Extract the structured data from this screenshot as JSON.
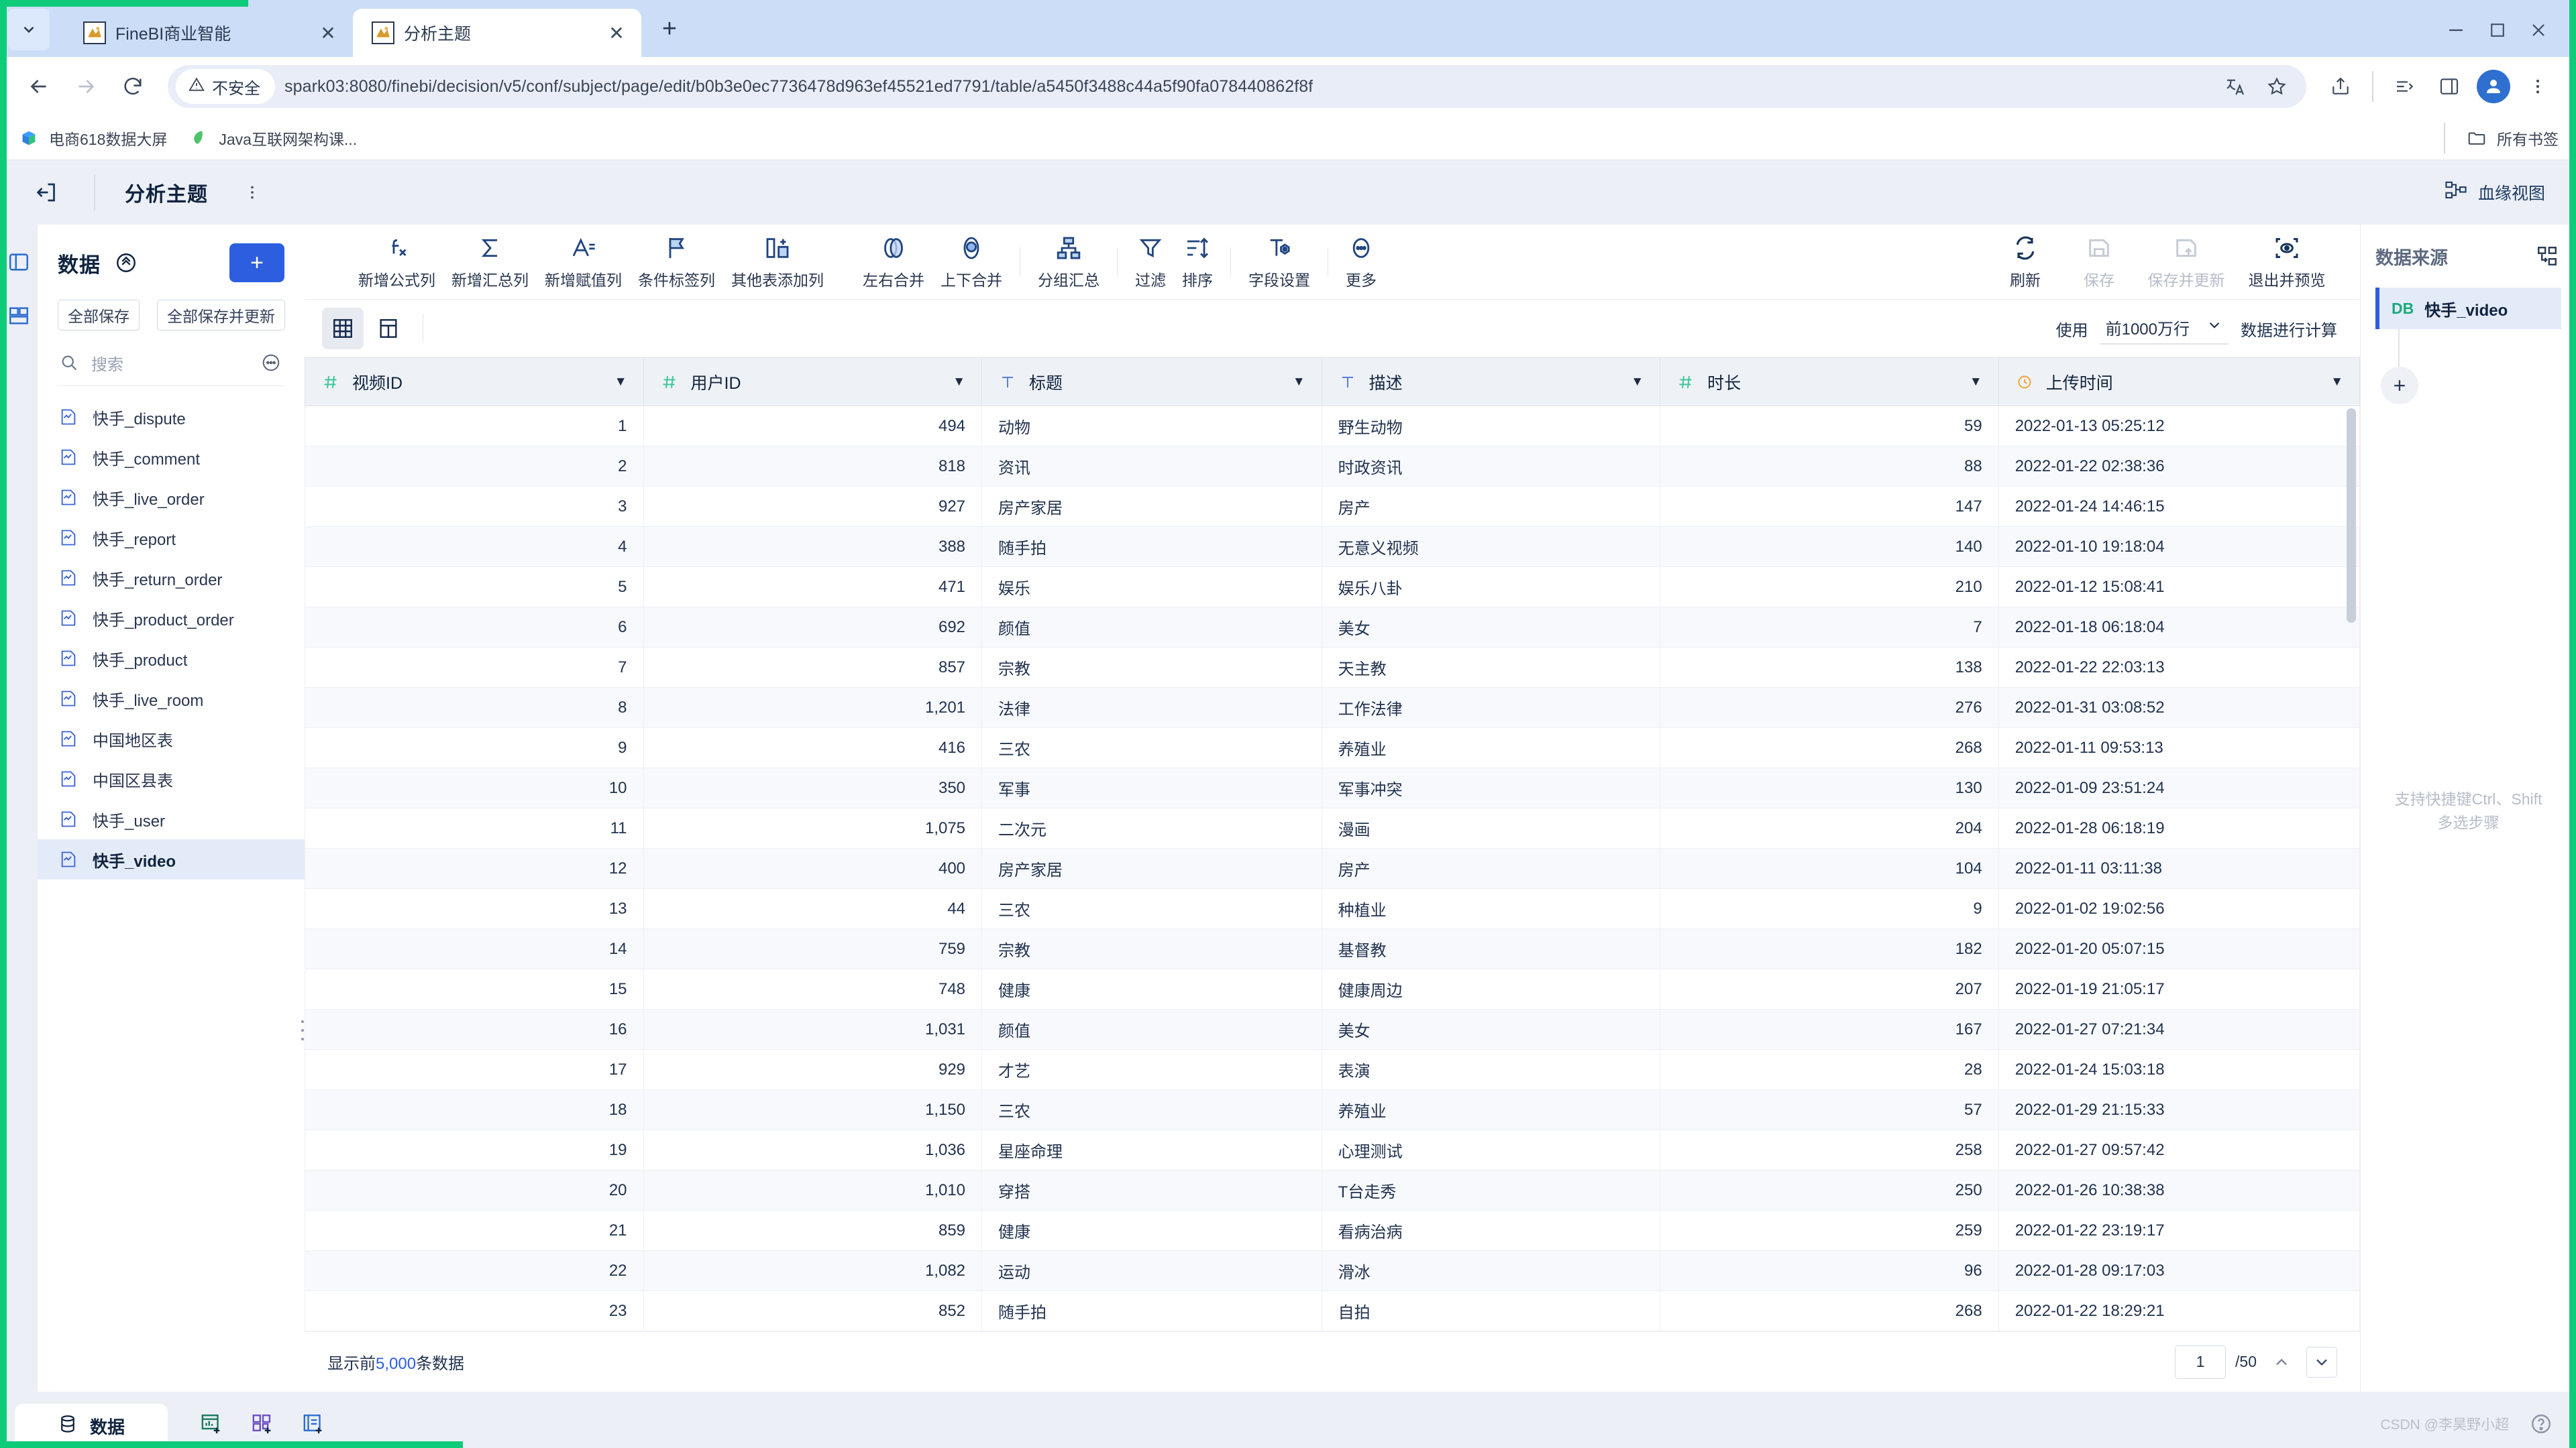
{
  "browser": {
    "tabs": [
      {
        "title": "FineBI商业智能",
        "favicon": "finebi-icon",
        "active": false
      },
      {
        "title": "分析主题",
        "favicon": "finebi-icon",
        "active": true
      }
    ],
    "new_tab_label": "+",
    "tab_close_label": "✕",
    "tab_list_label": "⌄",
    "nav": {
      "back": "←",
      "forward": "→",
      "reload": "⟳"
    },
    "security_label": "不安全",
    "security_icon": "warning-triangle-icon",
    "url": "spark03:8080/finebi/decision/v5/conf/subject/page/edit/b0b3e0ec7736478d963ef45521ed7791/table/a5450f3488c44a5f90fa078440862f8f",
    "bookmarks": [
      {
        "label": "电商618数据大屏",
        "icon": "shopping-icon"
      },
      {
        "label": "Java互联网架构课...",
        "icon": "leaf-icon"
      }
    ],
    "all_bookmarks_label": "所有书签",
    "all_bookmarks_icon": "folder-icon"
  },
  "app_header": {
    "back_icon": "exit-left-icon",
    "title": "分析主题",
    "more_icon": "vertical-dots-icon",
    "lineage_label": "血缘视图",
    "lineage_icon": "lineage-graph-icon"
  },
  "rail": {
    "items": [
      {
        "icon": "data-panel-icon"
      },
      {
        "icon": "component-panel-icon"
      }
    ]
  },
  "left_panel": {
    "title": "数据",
    "collapse_icon": "collapse-up-icon",
    "add_label": "+",
    "save_all_label": "全部保存",
    "save_update_all_label": "全部保存并更新",
    "search_placeholder": "搜索",
    "search_value": "",
    "search_icon": "search-icon",
    "more_icon": "more-circle-icon",
    "tables": [
      {
        "name": "快手_dispute",
        "selected": false
      },
      {
        "name": "快手_comment",
        "selected": false
      },
      {
        "name": "快手_live_order",
        "selected": false
      },
      {
        "name": "快手_report",
        "selected": false
      },
      {
        "name": "快手_return_order",
        "selected": false
      },
      {
        "name": "快手_product_order",
        "selected": false
      },
      {
        "name": "快手_product",
        "selected": false
      },
      {
        "name": "快手_live_room",
        "selected": false
      },
      {
        "name": "中国地区表",
        "selected": false
      },
      {
        "name": "中国区县表",
        "selected": false
      },
      {
        "name": "快手_user",
        "selected": false
      },
      {
        "name": "快手_video",
        "selected": true
      }
    ]
  },
  "toolbar": {
    "left_ops": [
      {
        "label": "新增公式列",
        "icon": "formula-fx-icon",
        "disabled": false
      },
      {
        "label": "新增汇总列",
        "icon": "sigma-icon",
        "disabled": false
      },
      {
        "label": "新增赋值列",
        "icon": "assign-column-icon",
        "disabled": false
      },
      {
        "label": "条件标签列",
        "icon": "flag-icon",
        "disabled": false
      },
      {
        "label": "其他表添加列",
        "icon": "add-column-icon",
        "disabled": false
      }
    ],
    "merge_ops": [
      {
        "label": "左右合并",
        "icon": "join-horizontal-icon",
        "disabled": false
      },
      {
        "label": "上下合并",
        "icon": "union-vertical-icon",
        "disabled": false
      }
    ],
    "group_ops": [
      {
        "label": "分组汇总",
        "icon": "group-summary-icon",
        "disabled": false
      }
    ],
    "filter_ops": [
      {
        "label": "过滤",
        "icon": "funnel-icon",
        "disabled": false
      },
      {
        "label": "排序",
        "icon": "sort-icon",
        "disabled": false
      }
    ],
    "field_ops": [
      {
        "label": "字段设置",
        "icon": "field-settings-icon",
        "disabled": false
      }
    ],
    "more_ops": [
      {
        "label": "更多",
        "icon": "ellipsis-circle-icon",
        "disabled": false
      }
    ],
    "right_ops": [
      {
        "label": "刷新",
        "icon": "refresh-icon",
        "disabled": false
      },
      {
        "label": "保存",
        "icon": "save-icon",
        "disabled": true
      },
      {
        "label": "保存并更新",
        "icon": "save-update-icon",
        "disabled": true
      },
      {
        "label": "退出并预览",
        "icon": "preview-exit-icon",
        "disabled": false
      }
    ]
  },
  "subbar": {
    "view_grid_icon": "grid-view-icon",
    "view_split_icon": "split-view-icon",
    "use_label": "使用",
    "row_limit_value": "前1000万行",
    "row_limit_caret": "chevron-down-icon",
    "compute_label": "数据进行计算"
  },
  "table": {
    "columns": [
      {
        "label": "视频ID",
        "type_icon": "number-hash-icon",
        "type": "number"
      },
      {
        "label": "用户ID",
        "type_icon": "number-hash-icon",
        "type": "number"
      },
      {
        "label": "标题",
        "type_icon": "text-t-icon",
        "type": "text"
      },
      {
        "label": "描述",
        "type_icon": "text-t-icon",
        "type": "text"
      },
      {
        "label": "时长",
        "type_icon": "number-hash-icon",
        "type": "number"
      },
      {
        "label": "上传时间",
        "type_icon": "clock-icon",
        "type": "datetime"
      }
    ],
    "rows": [
      [
        "1",
        "494",
        "动物",
        "野生动物",
        "59",
        "2022-01-13 05:25:12"
      ],
      [
        "2",
        "818",
        "资讯",
        "时政资讯",
        "88",
        "2022-01-22 02:38:36"
      ],
      [
        "3",
        "927",
        "房产家居",
        "房产",
        "147",
        "2022-01-24 14:46:15"
      ],
      [
        "4",
        "388",
        "随手拍",
        "无意义视频",
        "140",
        "2022-01-10 19:18:04"
      ],
      [
        "5",
        "471",
        "娱乐",
        "娱乐八卦",
        "210",
        "2022-01-12 15:08:41"
      ],
      [
        "6",
        "692",
        "颜值",
        "美女",
        "7",
        "2022-01-18 06:18:04"
      ],
      [
        "7",
        "857",
        "宗教",
        "天主教",
        "138",
        "2022-01-22 22:03:13"
      ],
      [
        "8",
        "1,201",
        "法律",
        "工作法律",
        "276",
        "2022-01-31 03:08:52"
      ],
      [
        "9",
        "416",
        "三农",
        "养殖业",
        "268",
        "2022-01-11 09:53:13"
      ],
      [
        "10",
        "350",
        "军事",
        "军事冲突",
        "130",
        "2022-01-09 23:51:24"
      ],
      [
        "11",
        "1,075",
        "二次元",
        "漫画",
        "204",
        "2022-01-28 06:18:19"
      ],
      [
        "12",
        "400",
        "房产家居",
        "房产",
        "104",
        "2022-01-11 03:11:38"
      ],
      [
        "13",
        "44",
        "三农",
        "种植业",
        "9",
        "2022-01-02 19:02:56"
      ],
      [
        "14",
        "759",
        "宗教",
        "基督教",
        "182",
        "2022-01-20 05:07:15"
      ],
      [
        "15",
        "748",
        "健康",
        "健康周边",
        "207",
        "2022-01-19 21:05:17"
      ],
      [
        "16",
        "1,031",
        "颜值",
        "美女",
        "167",
        "2022-01-27 07:21:34"
      ],
      [
        "17",
        "929",
        "才艺",
        "表演",
        "28",
        "2022-01-24 15:03:18"
      ],
      [
        "18",
        "1,150",
        "三农",
        "养殖业",
        "57",
        "2022-01-29 21:15:33"
      ],
      [
        "19",
        "1,036",
        "星座命理",
        "心理测试",
        "258",
        "2022-01-27 09:57:42"
      ],
      [
        "20",
        "1,010",
        "穿搭",
        "T台走秀",
        "250",
        "2022-01-26 10:38:38"
      ],
      [
        "21",
        "859",
        "健康",
        "看病治病",
        "259",
        "2022-01-22 23:19:17"
      ],
      [
        "22",
        "1,082",
        "运动",
        "滑冰",
        "96",
        "2022-01-28 09:17:03"
      ],
      [
        "23",
        "852",
        "随手拍",
        "自拍",
        "268",
        "2022-01-22 18:29:21"
      ]
    ]
  },
  "footer": {
    "showing_prefix": "显示前",
    "showing_count": "5,000",
    "showing_suffix": "条数据",
    "page_value": "1",
    "page_total": "/50",
    "prev_icon": "chevron-up-icon",
    "next_icon": "chevron-down-icon"
  },
  "right_panel": {
    "title": "数据来源",
    "header_icon": "flow-rearrange-icon",
    "node_badge": "DB",
    "node_name": "快手_video",
    "add_step_label": "+",
    "hint_line1": "支持快捷键Ctrl、Shift",
    "hint_line2": "多选步骤"
  },
  "bottom_bar": {
    "tab_label": "数据",
    "tab_icon": "database-icon",
    "icons": [
      {
        "icon": "add-chart-icon"
      },
      {
        "icon": "add-dashboard-icon"
      },
      {
        "icon": "add-report-icon"
      }
    ],
    "help_icon": "help-circle-icon",
    "watermark": "CSDN @李昊野小超"
  }
}
